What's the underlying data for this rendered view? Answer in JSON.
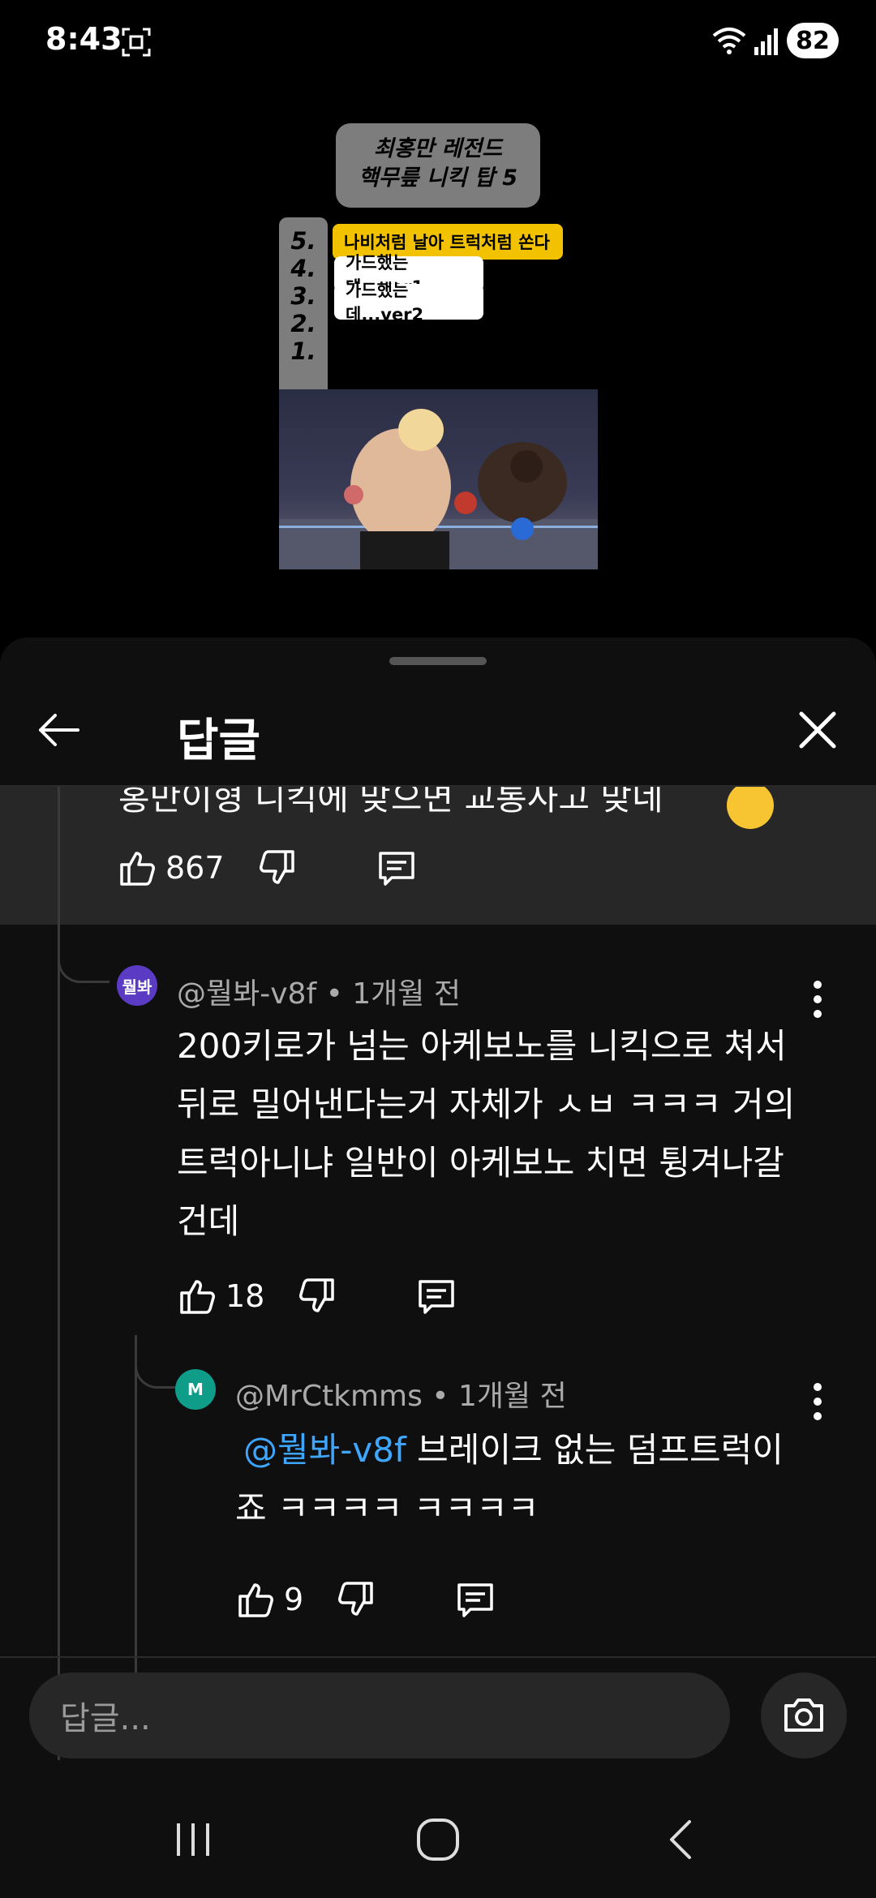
{
  "status_bar": {
    "time": "8:43",
    "battery": "82"
  },
  "video": {
    "title_line1": "최홍만 레전드",
    "title_line2": "핵무릎 니킥 탑 5",
    "ranks": [
      "5.",
      "4.",
      "3.",
      "2.",
      "1."
    ],
    "tag_yellow": "나비처럼 날아 트럭처럼 쏜다",
    "tag_white_1": "가드했는데...ver1",
    "tag_white_2": "가드했는데...ver2"
  },
  "sheet": {
    "title": "답글",
    "parent_comment": {
      "text_truncated": "홍만이형 니킥에 맞으면 교통사고 맞네",
      "likes": "867"
    },
    "replies": [
      {
        "avatar_text": "뭘봐",
        "avatar_color": "#5b3bc4",
        "author": "@뭘봐-v8f",
        "time": "1개월 전",
        "text": "200키로가 넘는 아케보노를 니킥으로 쳐서 뒤로 밀어낸다는거 자체가 ㅅㅂ ㅋㅋㅋ 거의 트럭아니냐 일반이 아케보노 치면 튕겨나갈건데",
        "likes": "18"
      },
      {
        "avatar_text": "M",
        "avatar_color": "#0f9d8a",
        "author": "@MrCtkmms",
        "time": "1개월 전",
        "mention": "@뭘봐-v8f",
        "text": " 브레이크 없는 덤프트럭이죠 ㅋㅋㅋㅋ ㅋㅋㅋㅋ",
        "likes": "9"
      }
    ],
    "meta_separator": " • ",
    "input_placeholder": "답글..."
  },
  "icons": {
    "status": [
      "screenshot-icon",
      "wifi-icon",
      "signal-icon"
    ],
    "header": [
      "back-arrow-icon",
      "close-icon"
    ],
    "actions": [
      "thumbs-up-icon",
      "thumbs-down-icon",
      "reply-comment-icon",
      "more-vert-icon"
    ],
    "input": [
      "camera-icon"
    ],
    "nav": [
      "recents-icon",
      "home-icon",
      "back-icon"
    ]
  },
  "colors": {
    "accent_mention": "#3ea6ff",
    "sheet_bg": "#0f0f0f",
    "highlight_bg": "#272727"
  }
}
